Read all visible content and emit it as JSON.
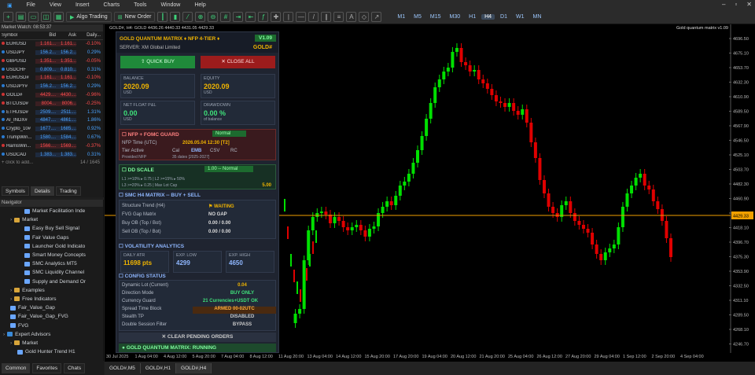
{
  "menu": [
    "File",
    "View",
    "Insert",
    "Charts",
    "Tools",
    "Window",
    "Help"
  ],
  "toolbar": {
    "algo": "Algo Trading",
    "neworder": "New Order",
    "timeframes": [
      "M1",
      "M5",
      "M15",
      "M30",
      "H1",
      "H4",
      "D1",
      "W1",
      "MN"
    ],
    "selected_tf": "H4"
  },
  "market_watch": {
    "title": "Market Watch: 08:53:37",
    "headers": [
      "Symbol",
      "Bid",
      "Ask",
      "Daily..."
    ],
    "rows": [
      [
        "EURUSD",
        "1.161...",
        "1.161...",
        "-0.10%",
        "neg"
      ],
      [
        "USDJPY",
        "156.2...",
        "156.2...",
        "0.29%",
        "pos"
      ],
      [
        "GBPUSD",
        "1.351...",
        "1.351...",
        "-0.05%",
        "neg"
      ],
      [
        "USDCHF",
        "0.809...",
        "0.810...",
        "0.31%",
        "pos"
      ],
      [
        "EURUSD#",
        "1.161...",
        "1.161...",
        "-0.10%",
        "neg"
      ],
      [
        "USDJPY#",
        "156.2...",
        "156.2...",
        "0.29%",
        "pos"
      ],
      [
        "GOLD#",
        "4429....",
        "4430....",
        "-0.96%",
        "neg"
      ],
      [
        "BTCUSD#",
        "8004...",
        "8006...",
        "-0.25%",
        "neg"
      ],
      [
        "ETHUSD#",
        "2509....",
        "2511....",
        "1.31%",
        "pos"
      ],
      [
        "AI_INDX#",
        "4847....",
        "4861....",
        "1.86%",
        "pos"
      ],
      [
        "Crypto_10#",
        "1677....",
        "1685....",
        "0.92%",
        "pos"
      ],
      [
        "TrumpWin...",
        "1580....",
        "1584....",
        "0.67%",
        "pos"
      ],
      [
        "HarrisWin...",
        "1566....",
        "1569....",
        "-0.37%",
        "neg"
      ],
      [
        "USDCAD",
        "1.383...",
        "1.383...",
        "0.31%",
        "pos"
      ]
    ],
    "add": "+ click to add...",
    "count": "14 / 1645",
    "tabs": [
      "Symbols",
      "Details",
      "Trading"
    ]
  },
  "navigator": {
    "title": "Navigator",
    "items": [
      [
        "Market Facilitation Inde",
        3,
        "ind"
      ],
      [
        "Market",
        1,
        "folder"
      ],
      [
        "Easy Buy Sell Signal",
        3,
        "ind"
      ],
      [
        "Fair Value Gaps",
        3,
        "ind"
      ],
      [
        "Launcher Gold Indicato",
        3,
        "ind"
      ],
      [
        "Smart Money Concepts",
        3,
        "ind"
      ],
      [
        "SMC Analytics MT5",
        3,
        "ind"
      ],
      [
        "SMC Liquidity Channel",
        3,
        "ind"
      ],
      [
        "Supply and Demand Or",
        3,
        "ind"
      ],
      [
        "Examples",
        1,
        "folder"
      ],
      [
        "Free Indicators",
        1,
        "folder"
      ],
      [
        "Fair_Value_Gap",
        1,
        "ind"
      ],
      [
        "Fair_Value_Gap_FVG",
        1,
        "ind"
      ],
      [
        "FVG",
        1,
        "ind"
      ],
      [
        "Expert Advisors",
        0,
        "ea"
      ],
      [
        "Market",
        1,
        "folder"
      ],
      [
        "Gold Hunter Trend H1",
        2,
        "ind"
      ]
    ],
    "bottom_tabs": [
      "Common",
      "Favorites",
      "Chats"
    ]
  },
  "chart": {
    "title": "GOLD#, H4:  GOLD  4436.26  4440.33  4431.05  4429.33",
    "label": "Gold quantum matrix v1.09",
    "current_price": "4429.33",
    "price_ticks": [
      "4696.50",
      "4675.10",
      "4653.70",
      "4632.30",
      "4610.90",
      "4589.50",
      "4567.90",
      "4546.50",
      "4525.10",
      "4503.70",
      "4482.30",
      "4460.90",
      "4439.50",
      "4418.10",
      "4396.70",
      "4375.30",
      "4353.90",
      "4332.50",
      "4311.10",
      "4289.50",
      "4268.10",
      "4246.70"
    ],
    "time_ticks": [
      "30 Jul 2025",
      "1 Aug 04:00",
      "4 Aug 12:00",
      "5 Aug 20:00",
      "7 Aug 04:00",
      "8 Aug 12:00",
      "11 Aug 20:00",
      "13 Aug 04:00",
      "14 Aug 12:00",
      "15 Aug 20:00",
      "17 Aug 20:00",
      "19 Aug 04:00",
      "20 Aug 12:00",
      "21 Aug 20:00",
      "25 Aug 04:00",
      "26 Aug 12:00",
      "27 Aug 20:00",
      "29 Aug 04:00",
      "1 Sep 12:00",
      "2 Sep 20:00",
      "4 Sep 04:00"
    ],
    "tabs": [
      "GOLD#,M5",
      "GOLD#,H1",
      "GOLD#,H4"
    ],
    "selected_tab": "GOLD#,H4"
  },
  "panel": {
    "title": "GOLD QUANTUM MATRIX ♦ NFP 4-TIER ♦",
    "version": "V1.09",
    "server": "SERVER: XM Global Limited",
    "symbol": "GOLD#",
    "quick_buy": "⇧ QUICK BUY",
    "close_all": "✕ CLOSE ALL",
    "balance_label": "BALANCE",
    "balance": "2020.09",
    "equity_label": "EQUITY",
    "equity": "2020.09",
    "usd": "USD",
    "netfloat_label": "NET FLOAT P&L",
    "netfloat": "0.00",
    "drawdown_label": "DRAWDOWN",
    "drawdown": "0.00 %",
    "of_balance": "of balance",
    "nfp_title": "☐ NFP + FOMC GUARD",
    "nfp_status": "Normal",
    "nfp_time_k": "NFP Time (UTC)",
    "nfp_time_v": "2026.05.04 12:30 [T2]",
    "tier_k": "Tier Active",
    "tier_c": [
      "Cal",
      "EMB",
      "CSV",
      "RC"
    ],
    "provided_k": "Provided NFP",
    "provided_v": "35 dates [2025-2027]",
    "dd_title": "☐ DD SCALE",
    "dd_status": "1.00 -- Normal",
    "dd_l1": "L1 >=10% ▸ 0.75 | L2 >=15% ▸ 50%",
    "dd_l2": "L3 >=20% ▸ 0.25 | Max Lot Cap",
    "dd_cap": "5.00",
    "smc_title": "☐ SMC H4 MATRIX -- BUY + SELL",
    "smc_rows": [
      [
        "Structure Trend (H4)",
        "⚑ WAITING"
      ],
      [
        "FVG Gap Matrix",
        "NO GAP"
      ],
      [
        "Buy OB (Top / Bot)",
        "0.00 / 0.00"
      ],
      [
        "Sell OB (Top / Bot)",
        "0.00 / 0.00"
      ]
    ],
    "vol_title": "☐ VOLATILITY ANALYTICS",
    "atr_label": "DAILY ATR",
    "atr": "11698 pts",
    "low_label": "EXP. LOW",
    "low": "4299",
    "high_label": "EXP. HIGH",
    "high": "4650",
    "cfg_title": "☐ CONFIG STATUS",
    "cfg_rows": [
      [
        "Dynamic Lot (Current)",
        "0.04"
      ],
      [
        "Direction Mode",
        "BUY ONLY"
      ],
      [
        "Currency Guard",
        "21 Currencies+USDT OK"
      ],
      [
        "Spread Time Block",
        "ARMED 00-02UTC"
      ],
      [
        "Stealth TP",
        "DISABLED"
      ],
      [
        "Double Session Filter",
        "BYPASS"
      ]
    ],
    "clear": "✕ CLEAR PENDING ORDERS",
    "running": "● GOLD QUANTUM MATRIX: RUNNING"
  },
  "colors": {
    "bull": "#00e000",
    "bear": "#e00000",
    "price_line": "#f0a000"
  }
}
